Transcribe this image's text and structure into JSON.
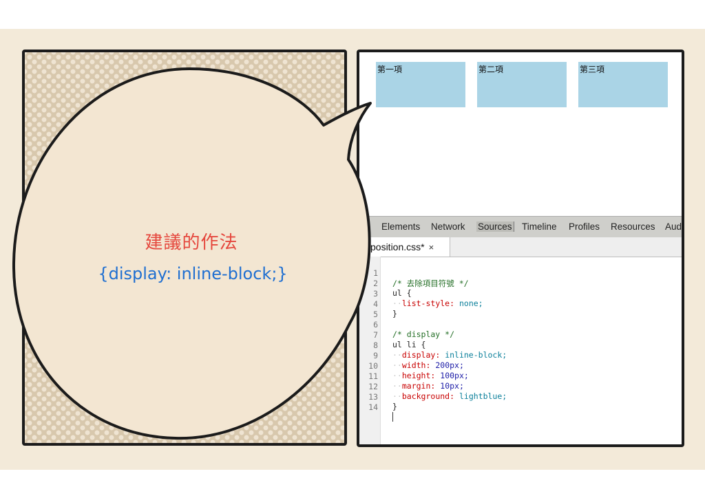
{
  "preview": {
    "items": [
      {
        "label": "第一項"
      },
      {
        "label": "第二項"
      },
      {
        "label": "第三項"
      }
    ],
    "box_color": "#aad4e6"
  },
  "devtools": {
    "tabs": [
      "Elements",
      "Network",
      "Sources",
      "Timeline",
      "Profiles",
      "Resources",
      "Aud"
    ],
    "selected_tab": "Sources",
    "file_tab": "position.css*",
    "file_close": "×"
  },
  "code": {
    "lines": [
      {
        "n": "1"
      },
      {
        "n": "2"
      },
      {
        "n": "3"
      },
      {
        "n": "4"
      },
      {
        "n": "5"
      },
      {
        "n": "6"
      },
      {
        "n": "7"
      },
      {
        "n": "8"
      },
      {
        "n": "9"
      },
      {
        "n": "10"
      },
      {
        "n": "11"
      },
      {
        "n": "12"
      },
      {
        "n": "13"
      },
      {
        "n": "14"
      }
    ],
    "l1_comment": "/* 去除項目符號 */",
    "l2_selector": "ul {",
    "l3_prop": "list-style:",
    "l3_val": "none;",
    "l4": "}",
    "l6_comment": "/* display */",
    "l7_selector": "ul li {",
    "l8_prop": "display:",
    "l8_val": "inline-block;",
    "l9_prop": "width:",
    "l9_val": "200px;",
    "l10_prop": "height:",
    "l10_val": "100px;",
    "l11_prop": "margin:",
    "l11_val": "10px;",
    "l12_prop": "background:",
    "l12_val": "lightblue;",
    "l13": "}"
  },
  "bubble": {
    "title": "建議的作法",
    "code": "{display: inline-block;}"
  },
  "colors": {
    "slide_bg": "#f3ead9",
    "title_red": "#e5473d",
    "code_blue": "#1f6fd1"
  }
}
